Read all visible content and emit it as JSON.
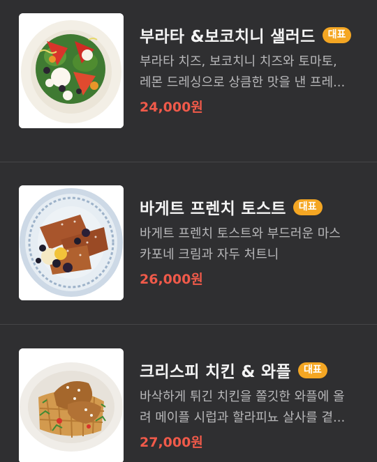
{
  "menu": {
    "items": [
      {
        "title": "부라타 &보코치니 샐러드",
        "badge": "대표",
        "desc_line1": "부라타 치즈, 보코치니 치즈와 토마토,",
        "desc_line2": "레몬 드레싱으로 상큼한 맛을 낸 프레...",
        "price": "24,000원",
        "image_icon": "salad-icon"
      },
      {
        "title": "바게트 프렌치 토스트",
        "badge": "대표",
        "desc_line1": "바게트 프렌치 토스트와 부드러운 마스",
        "desc_line2": "카포네 크림과 자두 처트니",
        "price": "26,000원",
        "image_icon": "french-toast-icon"
      },
      {
        "title": "크리스피 치킨 & 와플",
        "badge": "대표",
        "desc_line1": "바삭하게 튀긴 치킨을 쫄깃한 와플에 올",
        "desc_line2": "려 메이플 시럽과 할라피뇨 살사를 곁...",
        "price": "27,000원",
        "image_icon": "chicken-waffle-icon"
      }
    ]
  },
  "colors": {
    "background": "#2f2f31",
    "badge": "#f4a623",
    "price": "#f05a4a",
    "description": "#b8b8ba"
  }
}
